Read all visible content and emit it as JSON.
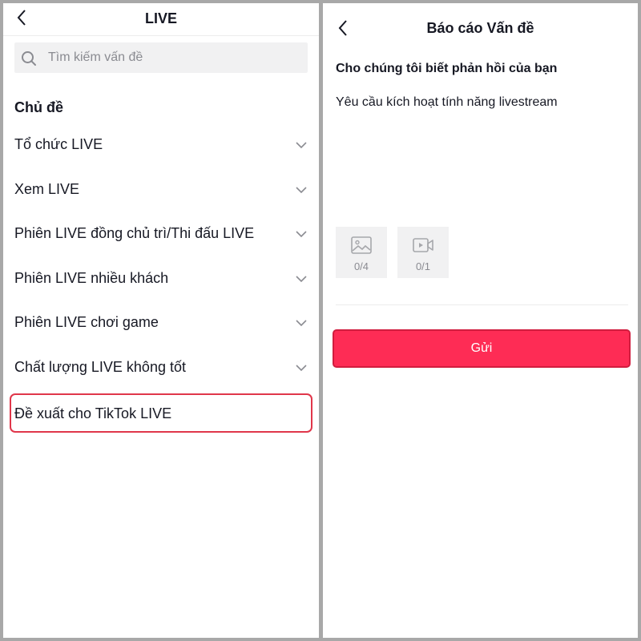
{
  "colors": {
    "accent": "#fe2c55",
    "highlight_border": "#e0364a",
    "text_primary": "#161823",
    "text_secondary": "#8a8b91",
    "search_bg": "#f1f1f2"
  },
  "left": {
    "header": {
      "title": "LIVE",
      "back_icon": "chevron-left-icon"
    },
    "search": {
      "placeholder": "Tìm kiếm vấn đề",
      "value": "",
      "icon": "search-icon"
    },
    "section_title": "Chủ đề",
    "topics": [
      {
        "label": "Tổ chức LIVE",
        "icon": "chevron-down-icon"
      },
      {
        "label": "Xem LIVE",
        "icon": "chevron-down-icon"
      },
      {
        "label": "Phiên LIVE đồng chủ trì/Thi đấu LIVE",
        "icon": "chevron-down-icon"
      },
      {
        "label": "Phiên LIVE nhiều khách",
        "icon": "chevron-down-icon"
      },
      {
        "label": "Phiên LIVE chơi game",
        "icon": "chevron-down-icon"
      },
      {
        "label": "Chất lượng LIVE không tốt",
        "icon": "chevron-down-icon"
      },
      {
        "label": "Đề xuất cho TikTok LIVE",
        "highlighted": true
      }
    ]
  },
  "right": {
    "header": {
      "title": "Báo cáo Vấn đề",
      "back_icon": "chevron-left-icon"
    },
    "feedback_title": "Cho chúng tôi biết phản hồi của bạn",
    "feedback_text": "Yêu cầu kích hoạt tính năng livestream",
    "uploads": [
      {
        "type": "image",
        "icon": "image-icon",
        "count": "0/4"
      },
      {
        "type": "video",
        "icon": "video-icon",
        "count": "0/1"
      }
    ],
    "submit_label": "Gửi"
  }
}
